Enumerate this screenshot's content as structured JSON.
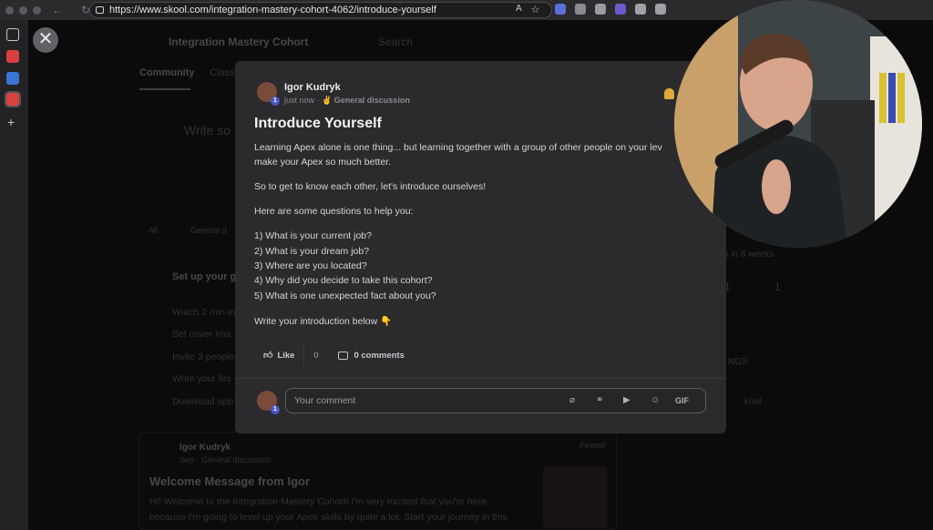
{
  "browser": {
    "url": "https://www.skool.com/integration-mastery-cohort-4062/introduce-yourself"
  },
  "background": {
    "group_name": "Integration Mastery Cohort",
    "search_placeholder": "Search",
    "tab_community": "Community",
    "tab_classroom": "Class",
    "write_placeholder": "Write so",
    "chip_all": "All",
    "chip_general": "General d",
    "setup_title": "Set up your gr",
    "checklist": [
      "Watch 2 min in",
      "Set cover ima",
      "Invite 3 people",
      "Write your firs",
      "Download app"
    ],
    "side_text_1": "ns in 8 weeks",
    "side_stat_1": "1",
    "side_stat_2": "1",
    "side_text_2": "NGS",
    "side_text_3": "kool",
    "pinned_author": "Igor Kudryk",
    "pinned_meta": "Sep · General discussion",
    "pinned_label": "Pinned",
    "pinned_title": "Welcome Message from Igor",
    "pinned_body_1": "Hi! Welcome to the Integration Mastery Cohort! I'm very excited that you're here,",
    "pinned_body_2": "because I'm going to level up your Apex skills by quite a lot. Start your journey in this"
  },
  "post": {
    "author": "Igor Kudryk",
    "level_badge": "1",
    "timestamp": "just now",
    "category": "General discussion",
    "title": "Introduce Yourself",
    "paragraph_1_line_1": "Learning Apex alone is one thing... but learning together with a group of other people on your lev",
    "paragraph_1_line_2": "make your Apex so much better.",
    "paragraph_2": "So to get to know each other, let's introduce ourselves!",
    "paragraph_3": "Here are some questions to help you:",
    "questions": [
      "1) What is your current job?",
      "2) What is your dream job?",
      "3) Where are you located?",
      "4) Why did you decide to take this cohort?",
      "5) What is one unexpected fact about you?"
    ],
    "paragraph_4": "Write your introduction below 👇",
    "like_label": "Like",
    "like_count": "0",
    "comments_label": "0 comments",
    "comment_placeholder": "Your comment",
    "gif_label": "GIF"
  },
  "colors": {
    "accent_badge": "#4a55c8",
    "bell": "#e0a83a",
    "modal_bg": "#2b2b2e"
  }
}
